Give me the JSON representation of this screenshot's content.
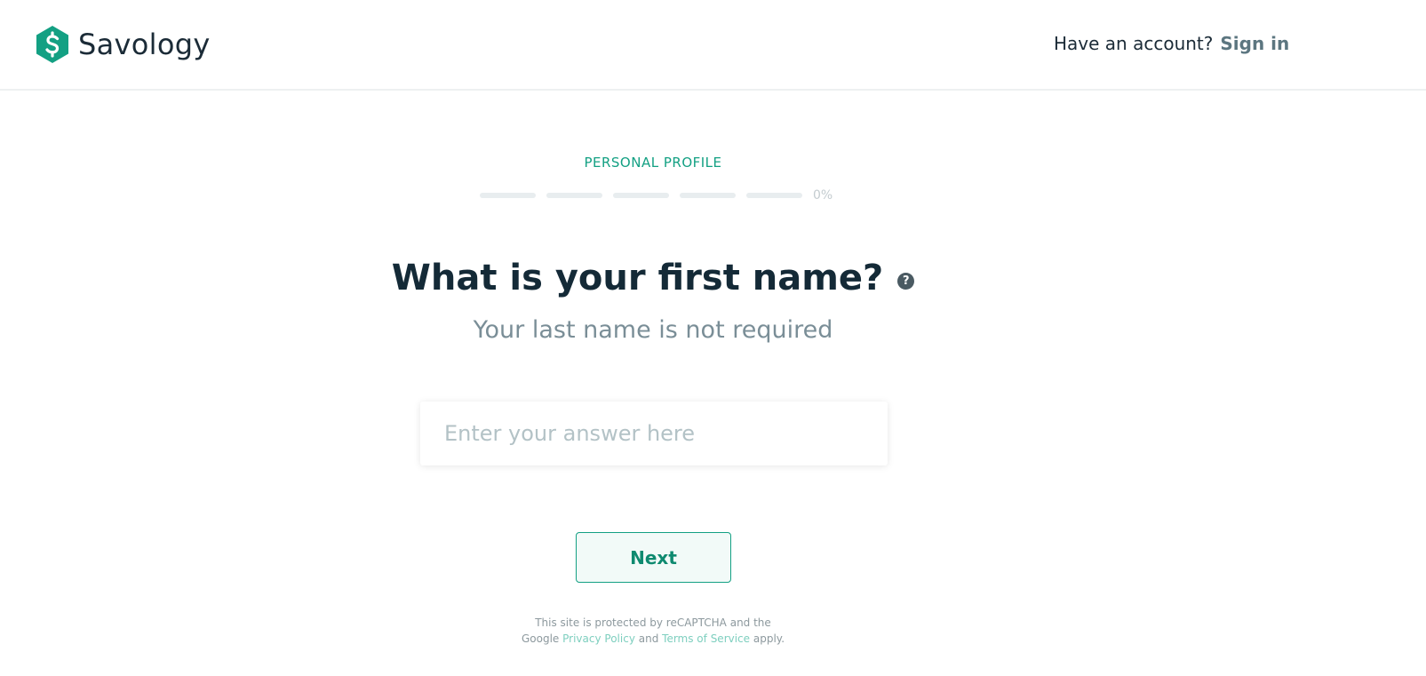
{
  "brand": {
    "name": "Savology",
    "color": "#13a083"
  },
  "header": {
    "account_prompt": "Have an account?",
    "signin_label": "Sign in"
  },
  "progress": {
    "step_label": "PERSONAL PROFILE",
    "segments_total": 5,
    "segments_completed": 0,
    "percent_text": "0%"
  },
  "question": {
    "title": "What is your first name?",
    "help_icon": "question-circle-icon",
    "help_glyph": "?",
    "subtitle": "Your last name is not required"
  },
  "answer": {
    "value": "",
    "placeholder": "Enter your answer here"
  },
  "actions": {
    "next_label": "Next"
  },
  "legal": {
    "line1": "This site is protected by reCAPTCHA and the",
    "prefix": "Google",
    "privacy_label": "Privacy Policy",
    "and": "and",
    "terms_label": "Terms of Service",
    "suffix": "apply."
  }
}
